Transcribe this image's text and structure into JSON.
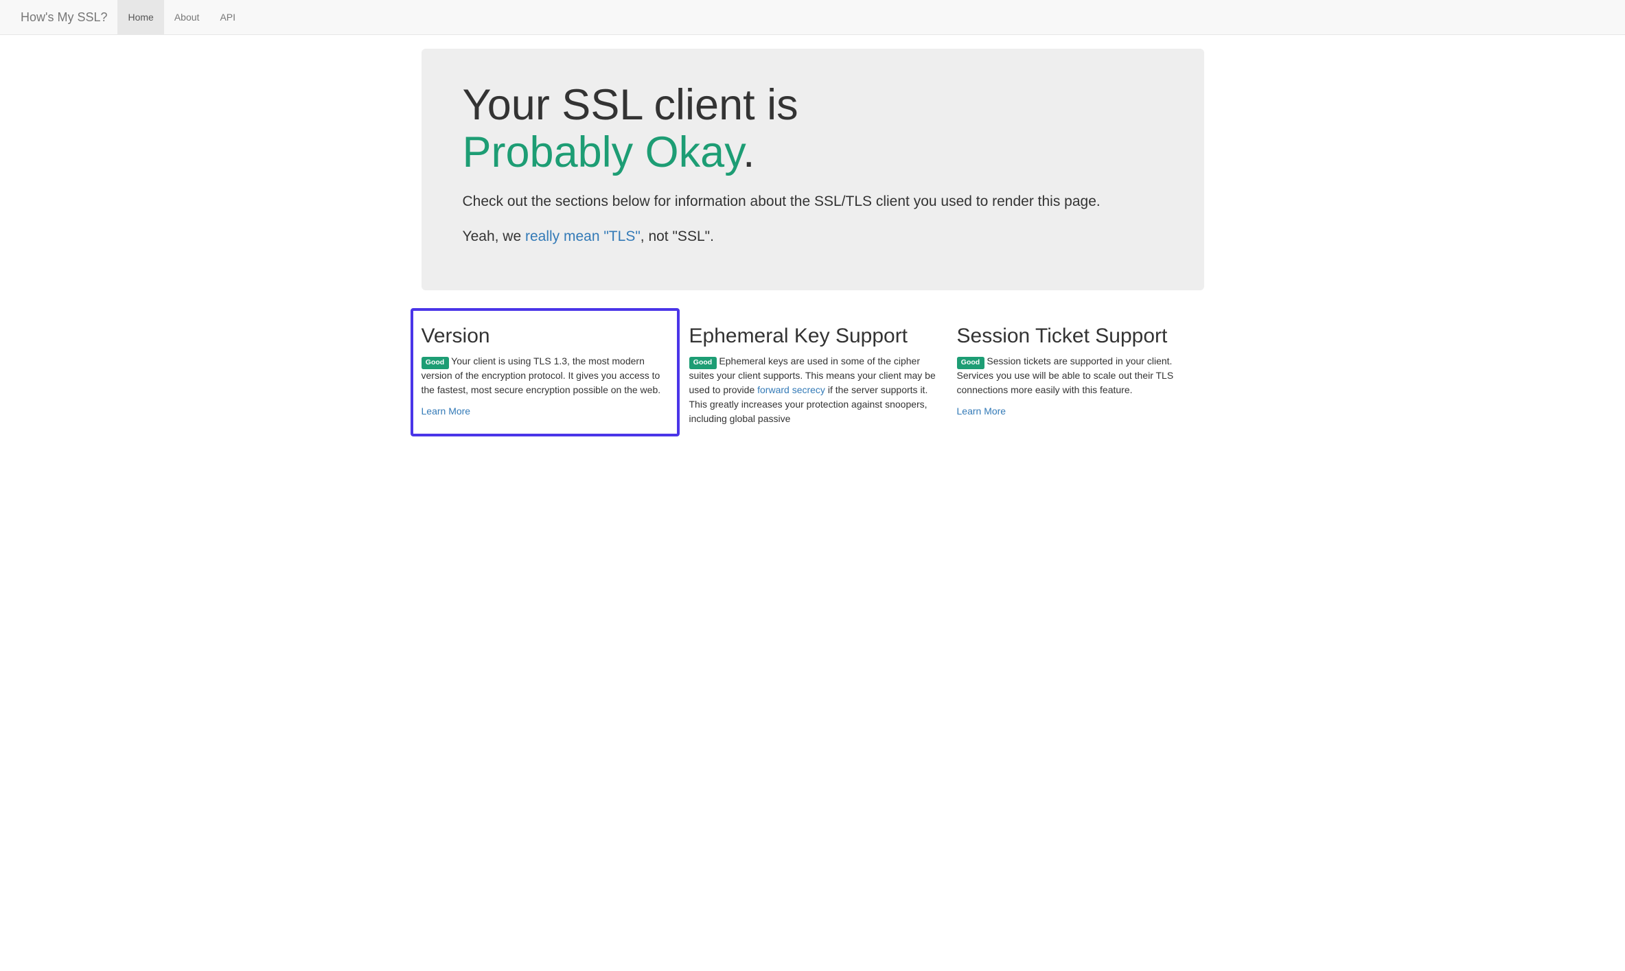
{
  "nav": {
    "brand": "How's My SSL?",
    "items": [
      {
        "label": "Home",
        "active": true
      },
      {
        "label": "About",
        "active": false
      },
      {
        "label": "API",
        "active": false
      }
    ]
  },
  "hero": {
    "line1": "Your SSL client is ",
    "rating": "Probably Okay",
    "dot": ".",
    "sub": "Check out the sections below for information about the SSL/TLS client you used to render this page.",
    "note_prefix": "Yeah, we ",
    "note_link": "really mean \"TLS\"",
    "note_suffix": ", not \"SSL\"."
  },
  "cards": {
    "version": {
      "title": "Version",
      "badge": "Good",
      "text": " Your client is using TLS 1.3, the most modern version of the encryption protocol. It gives you access to the fastest, most secure encryption possible on the web.",
      "learn": "Learn More"
    },
    "ephemeral": {
      "title": "Ephemeral Key Support",
      "badge": "Good",
      "text_before": " Ephemeral keys are used in some of the cipher suites your client supports. This means your client may be used to provide ",
      "link": "forward secrecy",
      "text_after": " if the server supports it. This greatly increases your protection against snoopers, including global passive"
    },
    "session": {
      "title": "Session Ticket Support",
      "badge": "Good",
      "text": " Session tickets are supported in your client. Services you use will be able to scale out their TLS connections more easily with this feature.",
      "learn": "Learn More"
    }
  }
}
